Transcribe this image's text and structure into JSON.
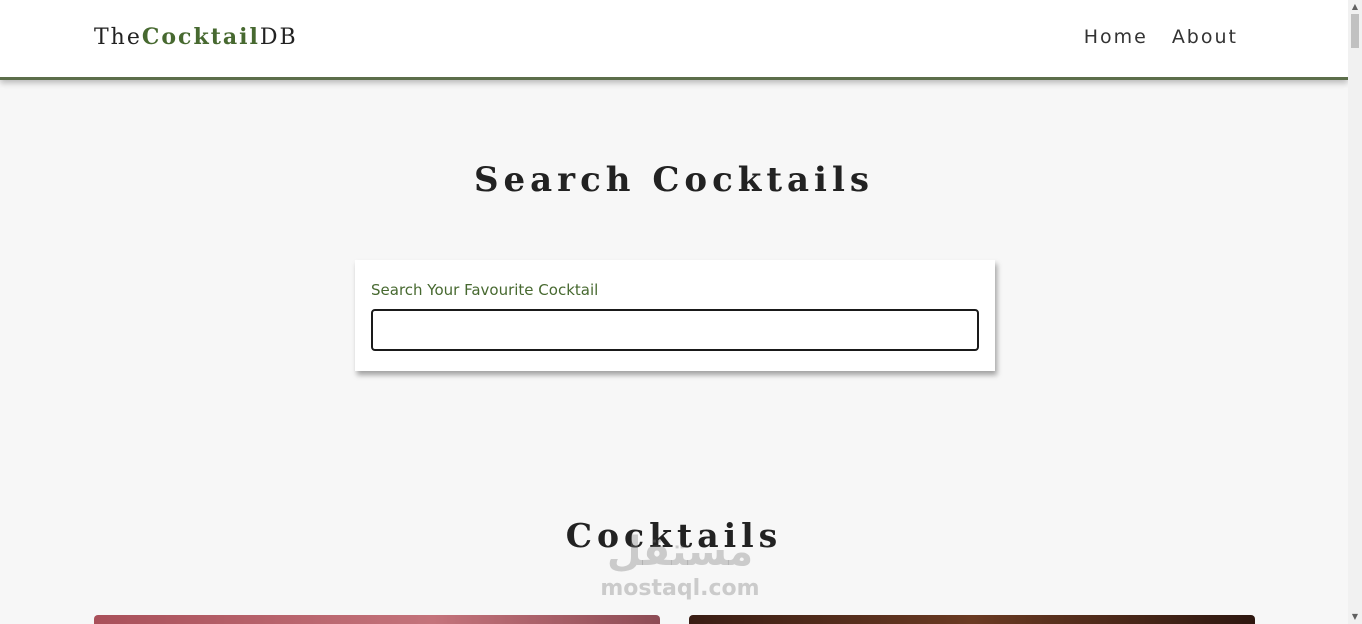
{
  "navbar": {
    "logo_prefix": "The",
    "logo_accent": "Cocktail",
    "logo_suffix": "DB",
    "links": [
      {
        "label": "Home"
      },
      {
        "label": "About"
      }
    ]
  },
  "search_section": {
    "title": "Search Cocktails",
    "label": "Search Your Favourite Cocktail",
    "input_value": ""
  },
  "cocktails_section": {
    "title": "Cocktails"
  },
  "watermark": {
    "arabic": "مستقل",
    "latin": "mostaql.com"
  },
  "scrollbar": {
    "up_icon": "▲",
    "down_icon": "▼"
  },
  "colors": {
    "accent": "#476930",
    "navbar_border": "#5c6e4a",
    "background": "#f7f7f7"
  }
}
